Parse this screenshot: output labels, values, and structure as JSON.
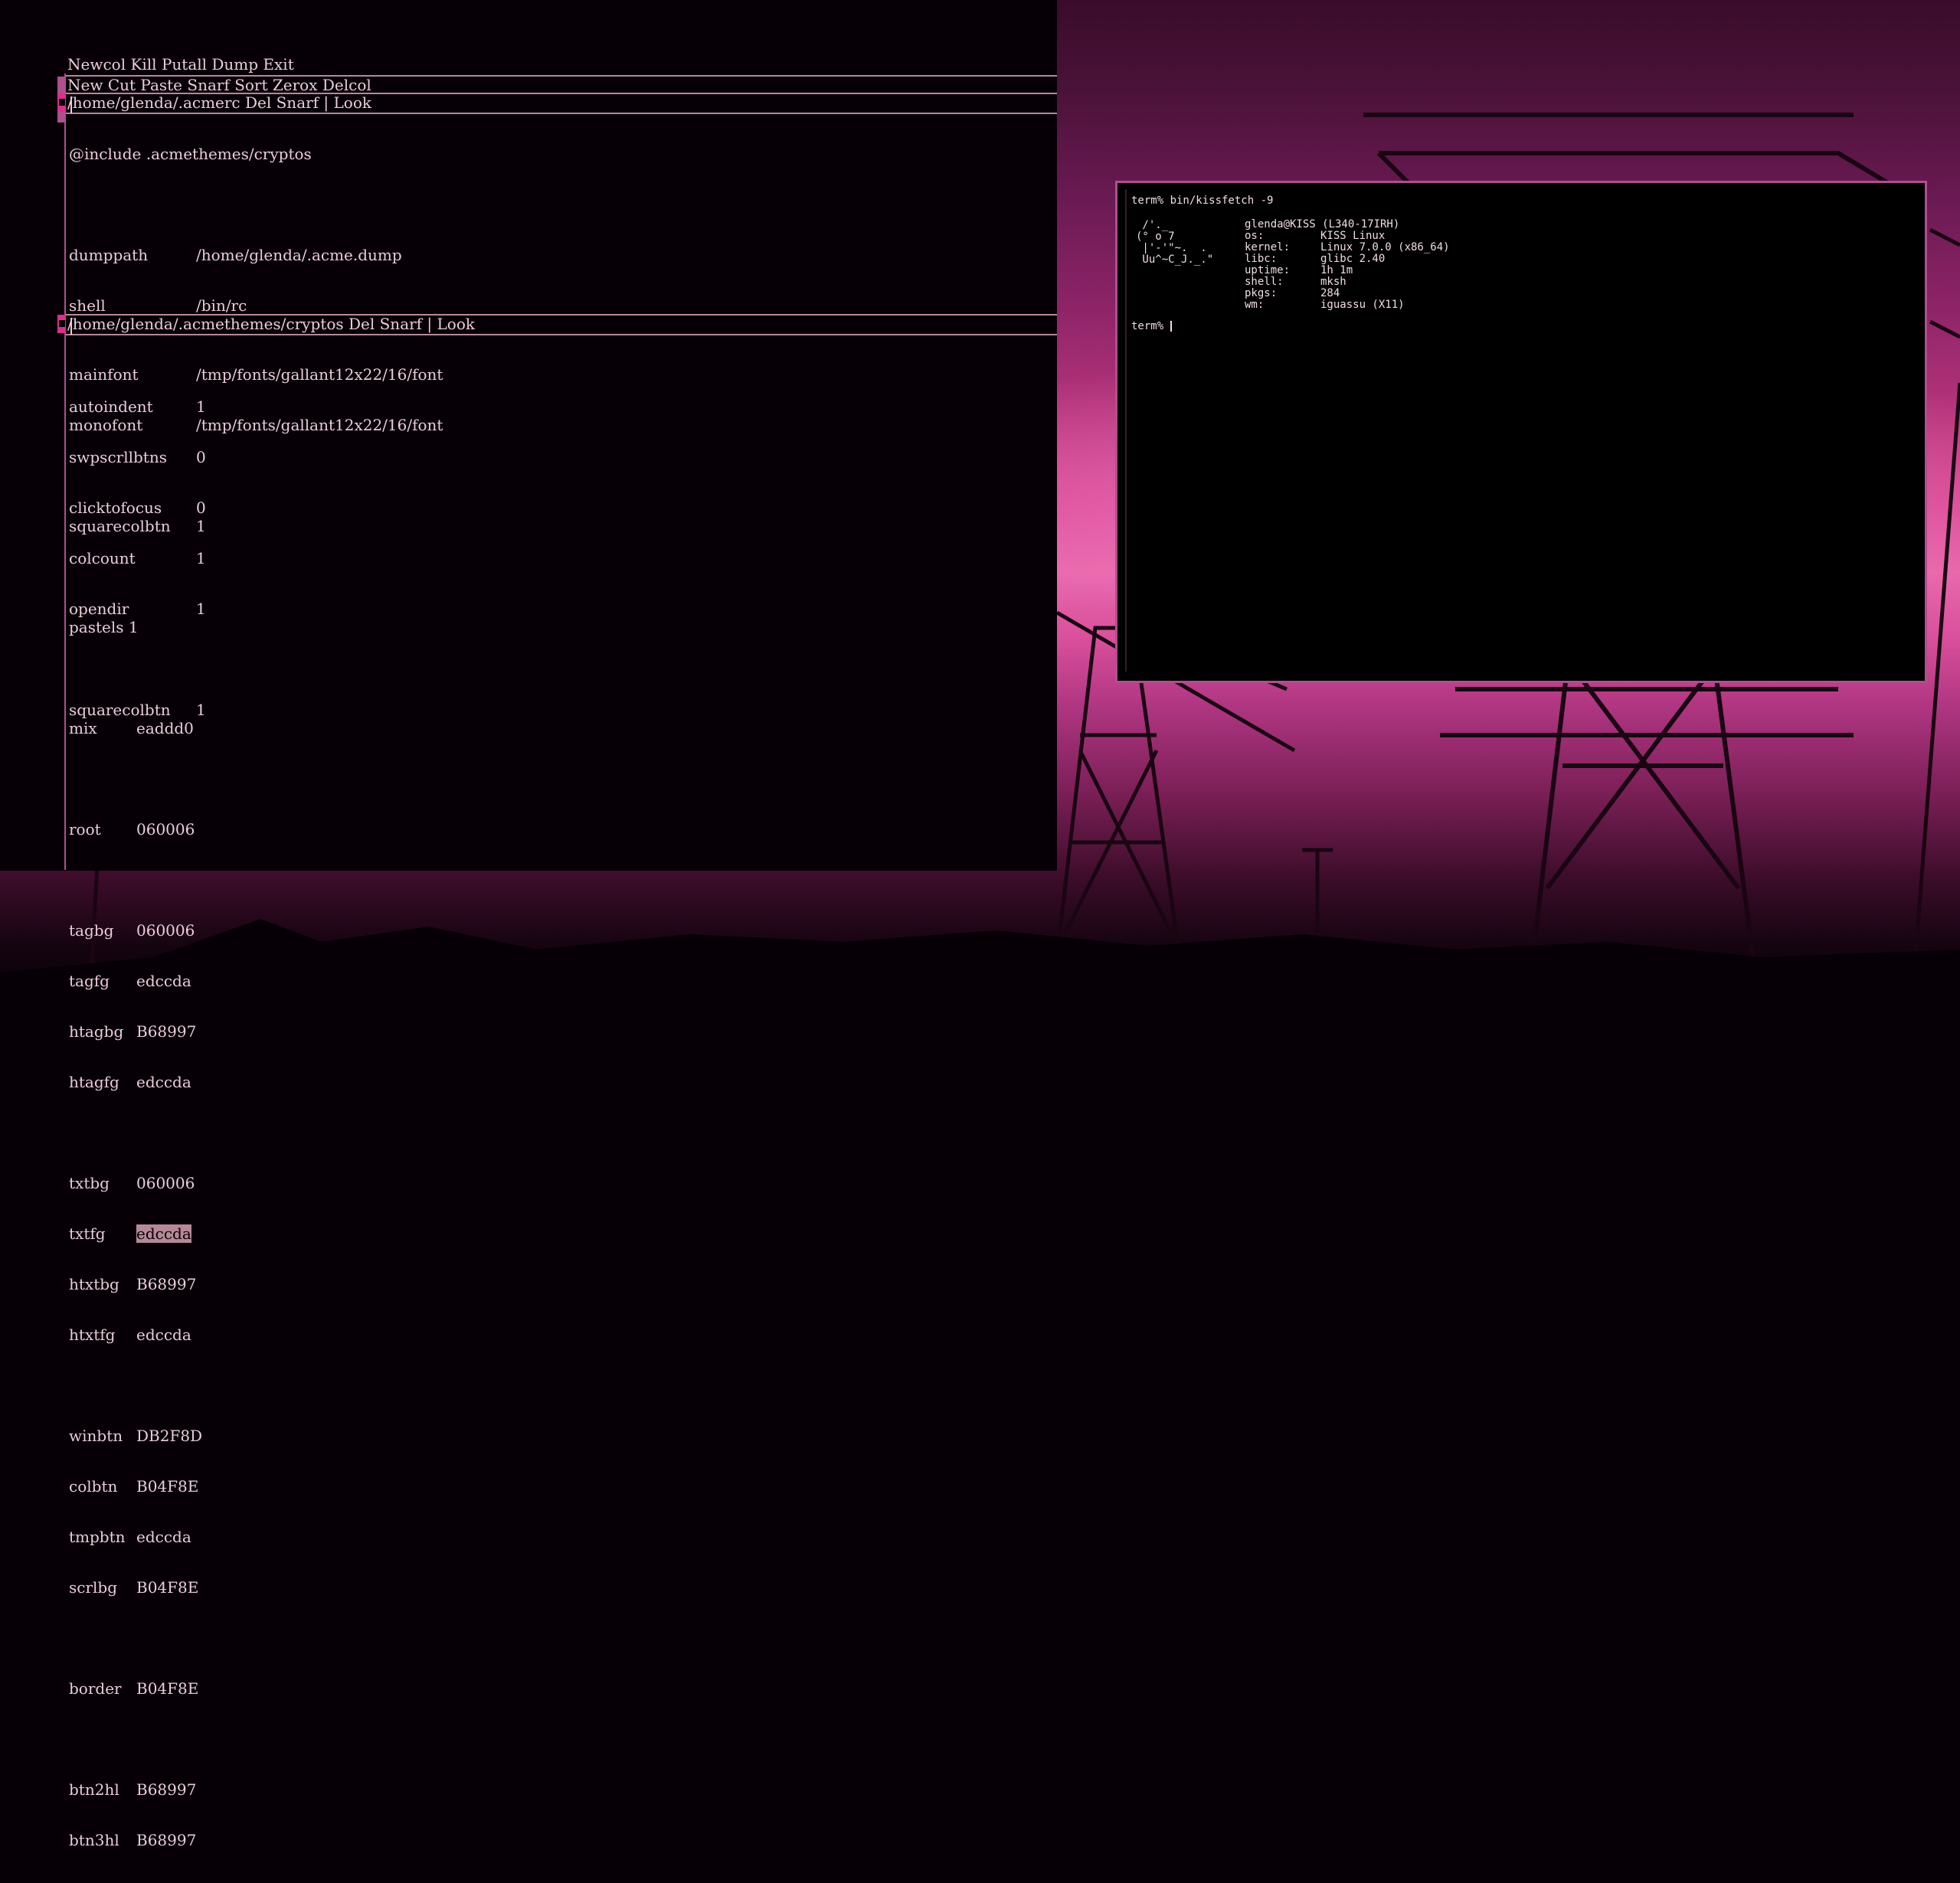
{
  "colors": {
    "root": "#060006",
    "tagbg": "#060006",
    "tagfg": "#edccda",
    "htagbg": "#B68997",
    "txtbg": "#060006",
    "txtfg": "#edccda",
    "winbtn": "#DB2F8D",
    "colbtn": "#B04F8E",
    "border": "#B04F8E"
  },
  "acme": {
    "column_tag": "Newcol Kill Putall Dump Exit",
    "window_tag_1": "New Cut Paste Snarf Sort Zerox Delcol",
    "window_tag_2": "/home/glenda/.acmerc Del Snarf | Look",
    "window_tag_3": "/home/glenda/.acmethemes/cryptos Del Snarf | Look",
    "acmerc": {
      "include": "@include .acmethemes/cryptos",
      "settings": [
        {
          "key": "dumppath",
          "value": "/home/glenda/.acme.dump"
        },
        {
          "key": "shell",
          "value": "/bin/rc"
        },
        {
          "key": "autoindent",
          "value": "1"
        },
        {
          "key": "swpscrllbtns",
          "value": "0"
        },
        {
          "key": "clicktofocus",
          "value": "0"
        },
        {
          "key": "colcount",
          "value": "1"
        },
        {
          "key": "opendir",
          "value": "1"
        },
        {
          "key": "squarecolbtn",
          "value": "1"
        }
      ]
    },
    "theme": {
      "fonts": [
        {
          "key": "mainfont",
          "value": "/tmp/fonts/gallant12x22/16/font"
        },
        {
          "key": "monofont",
          "value": "/tmp/fonts/gallant12x22/16/font"
        }
      ],
      "squarecolbtn": {
        "key": "squarecolbtn",
        "value": "1"
      },
      "pastels": "pastels 1",
      "palette": [
        {
          "key": "mix",
          "value": "eaddd0"
        },
        {
          "key": "root",
          "value": "060006"
        },
        {
          "key": "tagbg",
          "value": "060006"
        },
        {
          "key": "tagfg",
          "value": "edccda"
        },
        {
          "key": "htagbg",
          "value": "B68997"
        },
        {
          "key": "htagfg",
          "value": "edccda"
        },
        {
          "key": "txtbg",
          "value": "060006"
        },
        {
          "key": "txtfg",
          "value": "edccda"
        },
        {
          "key": "htxtbg",
          "value": "B68997"
        },
        {
          "key": "htxtfg",
          "value": "edccda"
        },
        {
          "key": "winbtn",
          "value": "DB2F8D"
        },
        {
          "key": "colbtn",
          "value": "B04F8E"
        },
        {
          "key": "tmpbtn",
          "value": "edccda"
        },
        {
          "key": "scrlbg",
          "value": "B04F8E"
        },
        {
          "key": "border",
          "value": "B04F8E"
        },
        {
          "key": "btn2hl",
          "value": "B68997"
        },
        {
          "key": "btn3hl",
          "value": "B68997"
        }
      ]
    }
  },
  "terminal": {
    "command": "term% bin/kissfetch -9",
    "art": [
      " /'._",
      "(° o 7",
      " |'-'\"~.  .",
      " Uu^~C_J._.\""
    ],
    "header": "glenda@KISS (L340-17IRH)",
    "info": [
      {
        "key": "os:",
        "value": "KISS Linux"
      },
      {
        "key": "kernel:",
        "value": "Linux 7.0.0 (x86_64)"
      },
      {
        "key": "libc:",
        "value": "glibc 2.40"
      },
      {
        "key": "uptime:",
        "value": "1h 1m"
      },
      {
        "key": "shell:",
        "value": "mksh"
      },
      {
        "key": "pkgs:",
        "value": "284"
      },
      {
        "key": "wm:",
        "value": "iguassu (X11)"
      }
    ],
    "prompt": "term%"
  }
}
